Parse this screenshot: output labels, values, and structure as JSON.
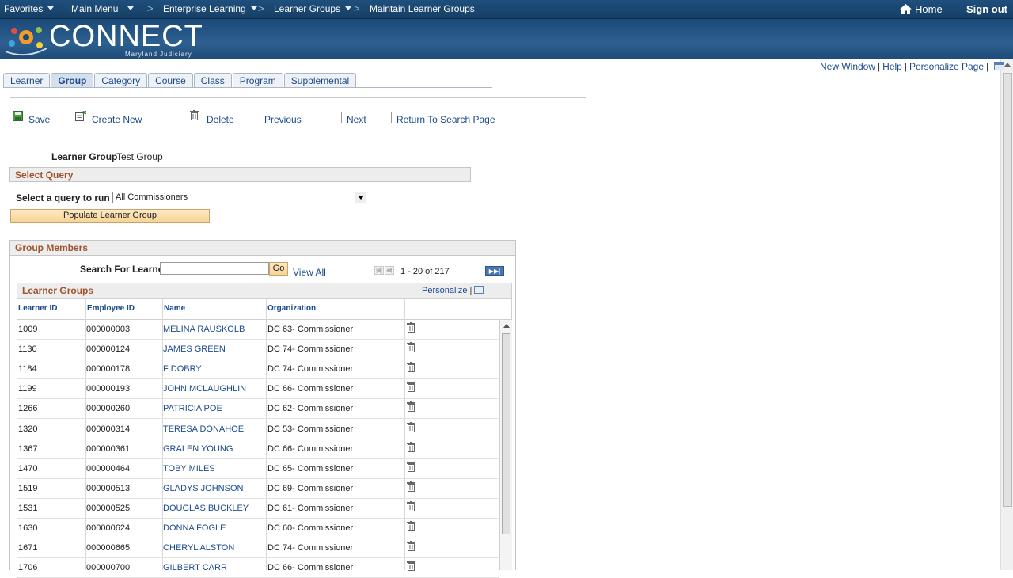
{
  "topnav": {
    "favorites": "Favorites",
    "main_menu": "Main Menu",
    "crumb1": "Enterprise Learning",
    "crumb2": "Learner Groups",
    "crumb3": "Maintain Learner Groups",
    "home": "Home",
    "signout": "Sign out",
    "sep": ">"
  },
  "banner": {
    "brand": "CONNECT",
    "subtitle": "Maryland Judiciary"
  },
  "pagelinks": {
    "new_window": "New Window",
    "help": "Help",
    "personalize": "Personalize Page",
    "bar": "|"
  },
  "tabs": [
    "Learner",
    "Group",
    "Category",
    "Course",
    "Class",
    "Program",
    "Supplemental"
  ],
  "toolbar": {
    "save": "Save",
    "create_new": "Create New",
    "delete": "Delete",
    "previous": "Previous",
    "next": "Next",
    "return": "Return To Search Page"
  },
  "learner_group": {
    "label": "Learner Group",
    "value": "Test Group"
  },
  "select_query": {
    "header": "Select Query",
    "label": "Select a query to run",
    "selected": "All Commissioners",
    "populate_button": "Populate Learner Group"
  },
  "group_members": {
    "header": "Group Members",
    "search_label": "Search For Learner",
    "go": "Go",
    "view_all": "View All",
    "pager": "1 - 20 of 217"
  },
  "grid": {
    "title": "Learner Groups",
    "personalize": "Personalize",
    "columns": [
      "Learner ID",
      "Employee ID",
      "Name",
      "Organization"
    ],
    "rows": [
      [
        "1009",
        "000000003",
        "MELINA RAUSKOLB",
        "DC 63- Commissioner"
      ],
      [
        "1130",
        "000000124",
        "JAMES GREEN",
        "DC 74- Commissioner"
      ],
      [
        "1184",
        "000000178",
        "F DOBRY",
        "DC 74- Commissioner"
      ],
      [
        "1199",
        "000000193",
        "JOHN MCLAUGHLIN",
        "DC 66- Commissioner"
      ],
      [
        "1266",
        "000000260",
        "PATRICIA POE",
        "DC 62- Commissioner"
      ],
      [
        "1320",
        "000000314",
        "TERESA DONAHOE",
        "DC 53- Commissioner"
      ],
      [
        "1367",
        "000000361",
        "GRALEN YOUNG",
        "DC 66- Commissioner"
      ],
      [
        "1470",
        "000000464",
        "TOBY MILES",
        "DC 65- Commissioner"
      ],
      [
        "1519",
        "000000513",
        "GLADYS JOHNSON",
        "DC 69- Commissioner"
      ],
      [
        "1531",
        "000000525",
        "DOUGLAS BUCKLEY",
        "DC 61- Commissioner"
      ],
      [
        "1630",
        "000000624",
        "DONNA FOGLE",
        "DC 60- Commissioner"
      ],
      [
        "1671",
        "000000665",
        "CHERYL ALSTON",
        "DC 74- Commissioner"
      ],
      [
        "1706",
        "000000700",
        "GILBERT CARR",
        "DC 66- Commissioner"
      ]
    ]
  },
  "colors": {
    "nav_bg": "#1f4f7d",
    "section_title": "#a0522d",
    "link": "#1a4a8c",
    "button_bg": "#f8d393"
  }
}
